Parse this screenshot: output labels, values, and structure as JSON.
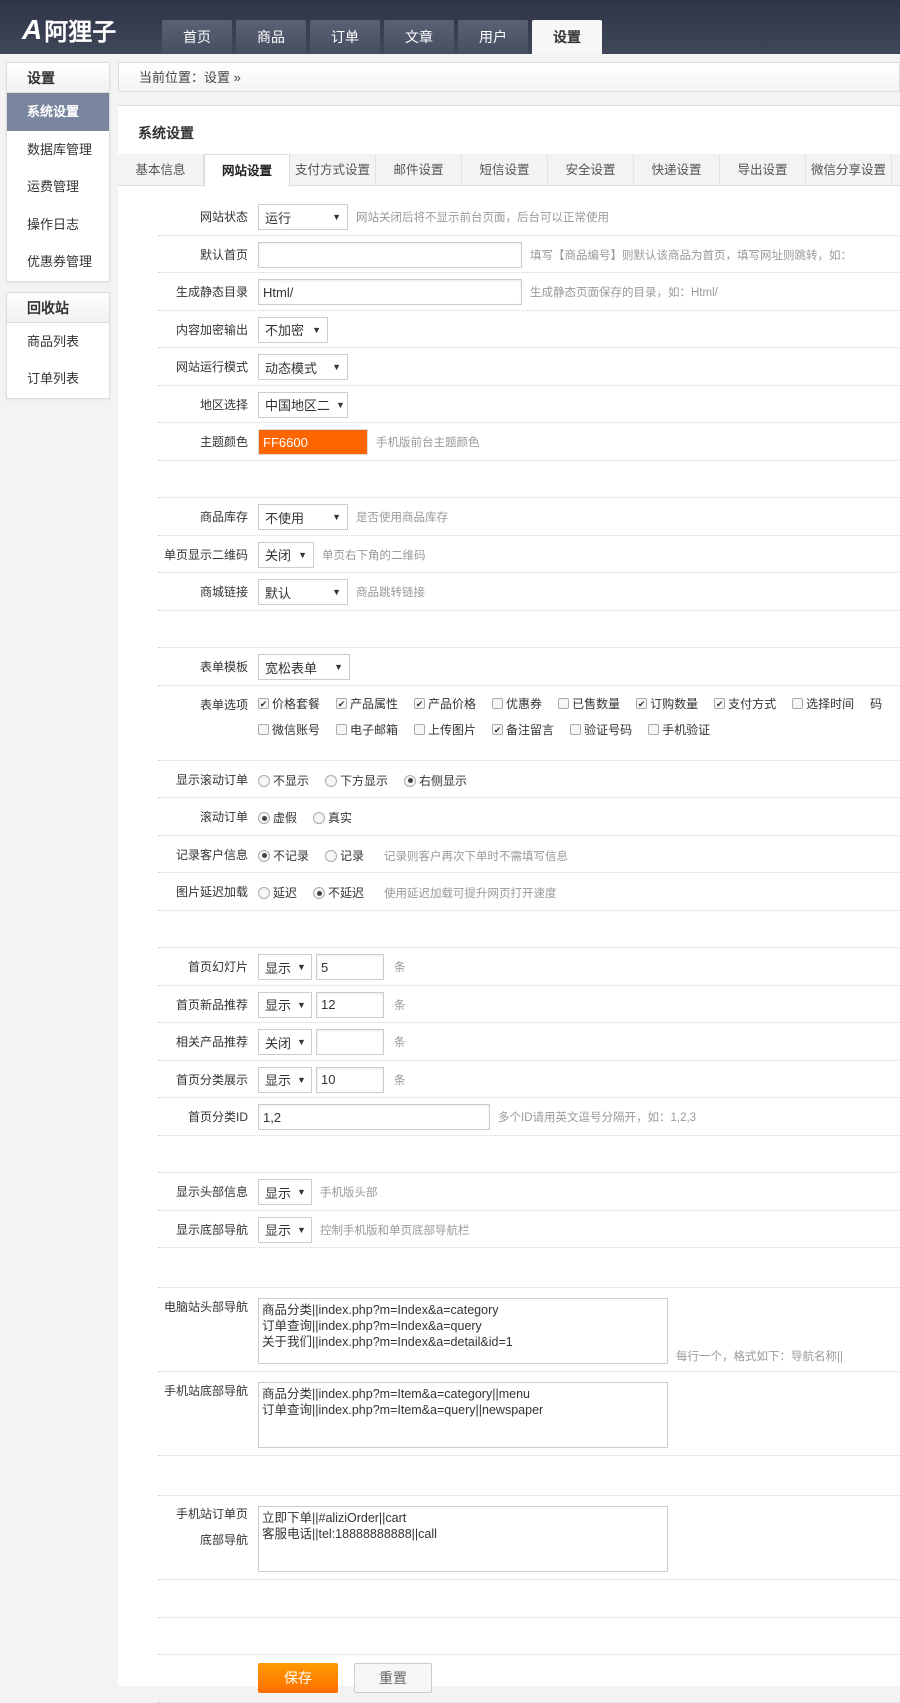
{
  "brand": "阿狸子",
  "nav": [
    "首页",
    "商品",
    "订单",
    "文章",
    "用户",
    "设置"
  ],
  "sidebar": {
    "group1": {
      "title": "设置",
      "items": [
        "系统设置",
        "数据库管理",
        "运费管理",
        "操作日志",
        "优惠券管理"
      ]
    },
    "group2": {
      "title": "回收站",
      "items": [
        "商品列表",
        "订单列表"
      ]
    }
  },
  "breadcrumb": "当前位置：设置 »",
  "page_title": "系统设置",
  "tabs": [
    "基本信息",
    "网站设置",
    "支付方式设置",
    "邮件设置",
    "短信设置",
    "安全设置",
    "快递设置",
    "导出设置",
    "微信分享设置"
  ],
  "form": {
    "site_status": {
      "label": "网站状态",
      "value": "运行",
      "hint": "网站关闭后将不显示前台页面，后台可以正常使用"
    },
    "default_home": {
      "label": "默认首页",
      "value": "",
      "hint": "填写【商品编号】则默认该商品为首页，填写网址则跳转，如："
    },
    "static_dir": {
      "label": "生成静态目录",
      "value": "Html/",
      "hint": "生成静态页面保存的目录，如：Html/"
    },
    "encrypt": {
      "label": "内容加密输出",
      "value": "不加密"
    },
    "run_mode": {
      "label": "网站运行模式",
      "value": "动态模式"
    },
    "region": {
      "label": "地区选择",
      "value": "中国地区二"
    },
    "theme_color": {
      "label": "主题颜色",
      "value": "FF6600",
      "hint": "手机版前台主题颜色",
      "color": "#ff6600"
    },
    "stock": {
      "label": "商品库存",
      "value": "不使用",
      "hint": "是否使用商品库存"
    },
    "qrcode": {
      "label": "单页显示二维码",
      "value": "关闭",
      "hint": "单页右下角的二维码"
    },
    "mall_link": {
      "label": "商城链接",
      "value": "默认",
      "hint": "商品跳转链接"
    },
    "form_tpl": {
      "label": "表单模板",
      "value": "宽松表单"
    },
    "form_opts": {
      "label": "表单选项",
      "items": [
        {
          "t": "价格套餐",
          "c": true
        },
        {
          "t": "产品属性",
          "c": true
        },
        {
          "t": "产品价格",
          "c": true
        },
        {
          "t": "优惠券",
          "c": false
        },
        {
          "t": "已售数量",
          "c": false
        },
        {
          "t": "订购数量",
          "c": true
        },
        {
          "t": "支付方式",
          "c": true
        },
        {
          "t": "选择时间",
          "c": false
        },
        {
          "t": "码",
          "c": null
        },
        {
          "t": "微信账号",
          "c": false
        },
        {
          "t": "电子邮箱",
          "c": false
        },
        {
          "t": "上传图片",
          "c": false
        },
        {
          "t": "备注留言",
          "c": true
        },
        {
          "t": "验证号码",
          "c": false
        },
        {
          "t": "手机验证",
          "c": false
        }
      ]
    },
    "scroll_show": {
      "label": "显示滚动订单",
      "opts": [
        "不显示",
        "下方显示",
        "右侧显示"
      ],
      "sel": 2
    },
    "scroll_order": {
      "label": "滚动订单",
      "opts": [
        "虚假",
        "真实"
      ],
      "sel": 0
    },
    "record_cust": {
      "label": "记录客户信息",
      "opts": [
        "不记录",
        "记录"
      ],
      "sel": 0,
      "hint": "记录则客户再次下单时不需填写信息"
    },
    "lazy": {
      "label": "图片延迟加载",
      "opts": [
        "延迟",
        "不延迟"
      ],
      "sel": 1,
      "hint": "使用延迟加载可提升网页打开速度"
    },
    "slides": {
      "label": "首页幻灯片",
      "sel": "显示",
      "num": "5",
      "unit": "条"
    },
    "new_rec": {
      "label": "首页新品推荐",
      "sel": "显示",
      "num": "12",
      "unit": "条"
    },
    "rel_rec": {
      "label": "相关产品推荐",
      "sel": "关闭",
      "num": "",
      "unit": "条"
    },
    "cat_show": {
      "label": "首页分类展示",
      "sel": "显示",
      "num": "10",
      "unit": "条"
    },
    "cat_id": {
      "label": "首页分类ID",
      "value": "1,2",
      "hint": "多个ID请用英文逗号分隔开，如：1,2,3"
    },
    "head_info": {
      "label": "显示头部信息",
      "value": "显示",
      "hint": "手机版头部"
    },
    "foot_nav": {
      "label": "显示底部导航",
      "value": "显示",
      "hint": "控制手机版和单页底部导航栏"
    },
    "pc_nav": {
      "label": "电脑站头部导航",
      "value": "商品分类||index.php?m=Index&a=category\n订单查询||index.php?m=Index&a=query\n关于我们||index.php?m=Index&a=detail&id=1",
      "hint": "每行一个，格式如下：导航名称||"
    },
    "m_nav": {
      "label": "手机站底部导航",
      "value": "商品分类||index.php?m=Item&a=category||menu\n订单查询||index.php?m=Item&a=query||newspaper"
    },
    "m_order_nav": {
      "label": "手机站订单页底部导航",
      "value": "立即下单||#aliziOrder||cart\n客服电话||tel:18888888888||call"
    },
    "save": "保存",
    "reset": "重置"
  }
}
